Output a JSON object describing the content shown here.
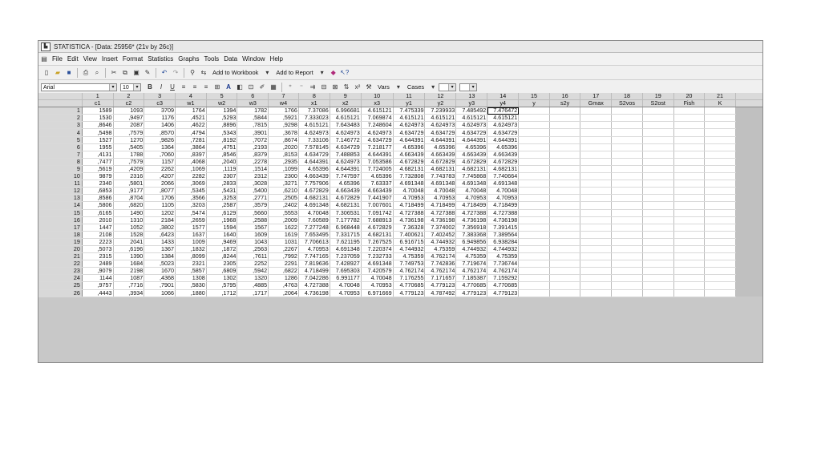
{
  "window": {
    "title": "STATISTICA - [Data: 25956* (21v by 26c)]"
  },
  "menu": [
    "File",
    "Edit",
    "View",
    "Insert",
    "Format",
    "Statistics",
    "Graphs",
    "Tools",
    "Data",
    "Window",
    "Help"
  ],
  "toolbar1": {
    "add_to_workbook": "Add to Workbook",
    "add_to_report": "Add to Report"
  },
  "toolbar2": {
    "font_name": "Arial",
    "font_size": "10",
    "bold": "B",
    "italic": "I",
    "underline": "U",
    "vars": "Vars",
    "cases": "Cases"
  },
  "columns": [
    {
      "n": "1",
      "name": "c1"
    },
    {
      "n": "2",
      "name": "c2"
    },
    {
      "n": "3",
      "name": "c3"
    },
    {
      "n": "4",
      "name": "w1"
    },
    {
      "n": "5",
      "name": "w2"
    },
    {
      "n": "6",
      "name": "w3"
    },
    {
      "n": "7",
      "name": "w4"
    },
    {
      "n": "8",
      "name": "x1"
    },
    {
      "n": "9",
      "name": "x2"
    },
    {
      "n": "10",
      "name": "x3"
    },
    {
      "n": "11",
      "name": "y1"
    },
    {
      "n": "12",
      "name": "y2"
    },
    {
      "n": "13",
      "name": "y3"
    },
    {
      "n": "14",
      "name": "y4"
    },
    {
      "n": "15",
      "name": "y"
    },
    {
      "n": "16",
      "name": "s2y"
    },
    {
      "n": "17",
      "name": "Gmax"
    },
    {
      "n": "18",
      "name": "S2vos"
    },
    {
      "n": "19",
      "name": "S2ost"
    },
    {
      "n": "20",
      "name": "Fish"
    },
    {
      "n": "21",
      "name": "K"
    }
  ],
  "selected": {
    "row": 1,
    "col": 14
  },
  "rows": [
    [
      "1589",
      "1093",
      "3709",
      "1764",
      "1394",
      "1782",
      "1766",
      "7.37086",
      "6.996681",
      "4.615121",
      "7.475339",
      "7.239933",
      "7.485492",
      "7.476472"
    ],
    [
      "1530",
      ",9497",
      "1176",
      ",4521",
      ",5293",
      ",5844",
      ",5921",
      "7.333023",
      "4.615121",
      "7.069874",
      "4.615121",
      "4.615121",
      "4.615121",
      "4.615121"
    ],
    [
      ",8646",
      "2087",
      "1406",
      ",4622",
      ",8896",
      ",7815",
      ",9298",
      "4.615121",
      "7.643483",
      "7.248604",
      "4.624973",
      "4.624973",
      "4.624973",
      "4.624973"
    ],
    [
      ",5498",
      ",7579",
      ",8570",
      ",4794",
      ",5343",
      ",3901",
      ",3678",
      "4.624973",
      "4.624973",
      "4.624973",
      "4.634729",
      "4.634729",
      "4.634729",
      "4.634729"
    ],
    [
      "1527",
      "1270",
      ",9826",
      ",7281",
      ",8192",
      ",7072",
      ",8674",
      "7.33106",
      "7.146772",
      "4.634729",
      "4.644391",
      "4.644391",
      "4.644391",
      "4.644391"
    ],
    [
      "1955",
      ",5405",
      "1364",
      ",3864",
      ",4751",
      ",2193",
      ",2020",
      "7.578145",
      "4.634729",
      "7.218177",
      "4.65396",
      "4.65396",
      "4.65396",
      "4.65396"
    ],
    [
      ",4131",
      "1788",
      ",7060",
      ",8397",
      ",8546",
      ",8379",
      ",8153",
      "4.634729",
      "7.488853",
      "4.644391",
      "4.663439",
      "4.663439",
      "4.663439",
      "4.663439"
    ],
    [
      ",7477",
      ",7579",
      "1157",
      ",4068",
      ",2040",
      ",2278",
      ",2935",
      "4.644391",
      "4.624973",
      "7.053586",
      "4.672829",
      "4.672829",
      "4.672829",
      "4.672829"
    ],
    [
      ",5619",
      ",4209",
      "2262",
      ",1069",
      ",1119",
      ",1514",
      ",1099",
      "4.65396",
      "4.644391",
      "7.724005",
      "4.682131",
      "4.682131",
      "4.682131",
      "4.682131"
    ],
    [
      "9879",
      "2316",
      ",4207",
      "2282",
      "2307",
      "2312",
      "2300",
      "4.663439",
      "7.747597",
      "4.65396",
      "7.732808",
      "7.743783",
      "7.745868",
      "7.740664"
    ],
    [
      "2340",
      ",5801",
      "2066",
      ",3069",
      ",2833",
      ",3028",
      ",3271",
      "7.757906",
      "4.65396",
      "7.63337",
      "4.691348",
      "4.691348",
      "4.691348",
      "4.691348"
    ],
    [
      ",6853",
      ",9177",
      ",8077",
      ",5345",
      ",5431",
      ",5400",
      ",6210",
      "4.672829",
      "4.663439",
      "4.663439",
      "4.70048",
      "4.70048",
      "4.70048",
      "4.70048"
    ],
    [
      ",8586",
      ",8704",
      "1706",
      ",3566",
      ",3253",
      ",2771",
      ",2505",
      "4.682131",
      "4.672829",
      "7.441907",
      "4.70953",
      "4.70953",
      "4.70953",
      "4.70953"
    ],
    [
      ",5806",
      ",6820",
      "1105",
      ",3203",
      ",2587",
      ",3579",
      ",2402",
      "4.691348",
      "4.682131",
      "7.007601",
      "4.718499",
      "4.718499",
      "4.718499",
      "4.718499"
    ],
    [
      ",6165",
      "1490",
      "1202",
      ",5474",
      ",6129",
      ",5660",
      ",5553",
      "4.70048",
      "7.306531",
      "7.091742",
      "4.727388",
      "4.727388",
      "4.727388",
      "4.727388"
    ],
    [
      "2010",
      "1310",
      "2184",
      ",2659",
      ",1968",
      ",2588",
      ",2009",
      "7.60589",
      "7.177782",
      "7.688913",
      "4.736198",
      "4.736198",
      "4.736198",
      "4.736198"
    ],
    [
      "1447",
      "1052",
      ",3802",
      "1577",
      "1594",
      "1567",
      "1622",
      "7.277248",
      "6.968448",
      "4.672829",
      "7.36328",
      "7.374002",
      "7.356918",
      "7.391415"
    ],
    [
      "2108",
      "1528",
      ",6423",
      "1637",
      "1640",
      "1609",
      "1619",
      "7.653495",
      "7.331715",
      "4.682131",
      "7.400621",
      "7.402452",
      "7.383368",
      "7.389564"
    ],
    [
      "2223",
      "2041",
      "1433",
      "1009",
      ",9469",
      "1043",
      "1031",
      "7.706613",
      "7.621195",
      "7.267525",
      "6.916715",
      "4.744932",
      "6.949856",
      "6.938284"
    ],
    [
      ",5073",
      ",6196",
      "1367",
      ",1832",
      ",1872",
      ",2563",
      ",2267",
      "4.70953",
      "4.691348",
      "7.220374",
      "4.744932",
      "4.75359",
      "4.744932",
      "4.744932"
    ],
    [
      "2315",
      "1390",
      "1384",
      ",8099",
      ",8244",
      ",7611",
      ",7992",
      "7.747165",
      "7.237059",
      "7.232733",
      "4.75359",
      "4.762174",
      "4.75359",
      "4.75359"
    ],
    [
      "2489",
      "1684",
      ",5023",
      "2321",
      "2305",
      "2252",
      "2291",
      "7.819636",
      "7.428927",
      "4.691348",
      "7.749753",
      "7.742836",
      "7.719674",
      "7.736744"
    ],
    [
      ",9079",
      "2198",
      "1670",
      ",5857",
      ",6809",
      ",5942",
      ",6822",
      "4.718499",
      "7.695303",
      "7.420579",
      "4.762174",
      "4.762174",
      "4.762174",
      "4.762174"
    ],
    [
      "1144",
      "1087",
      ",4368",
      "1308",
      "1302",
      "1320",
      "1286",
      "7.042286",
      "6.991177",
      "4.70048",
      "7.176255",
      "7.171657",
      "7.185387",
      "7.159292"
    ],
    [
      ",9757",
      ",7716",
      ",7901",
      ",5830",
      ",5795",
      ",4885",
      ",4763",
      "4.727388",
      "4.70048",
      "4.70953",
      "4.770685",
      "4.779123",
      "4.770685",
      "4.770685"
    ],
    [
      ",4443",
      ",3934",
      "1066",
      ",1880",
      ",1712",
      ",1717",
      ",2064",
      "4.736198",
      "4.70953",
      "6.971669",
      "4.779123",
      "4.787492",
      "4.779123",
      "4.779123"
    ]
  ]
}
